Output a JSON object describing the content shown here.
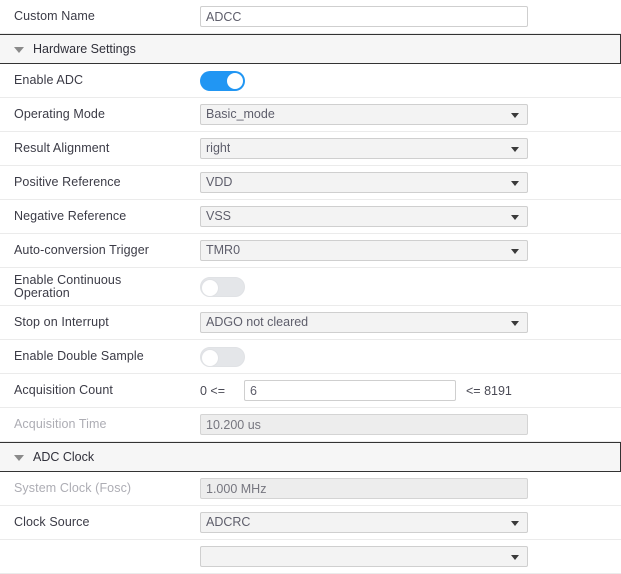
{
  "custom_name_row": {
    "label": "Custom Name",
    "value": "ADCC"
  },
  "sections": {
    "hardware_settings": {
      "title": "Hardware Settings",
      "caret": "caret-down-icon"
    },
    "adc_clock": {
      "title": "ADC Clock",
      "caret": "caret-down-icon"
    }
  },
  "help_glyph": "?",
  "rows": {
    "enable_adc": {
      "label": "Enable ADC",
      "toggle": "on"
    },
    "operating_mode": {
      "label": "Operating Mode",
      "value": "Basic_mode"
    },
    "result_alignment": {
      "label": "Result Alignment",
      "value": "right"
    },
    "positive_reference": {
      "label": "Positive Reference",
      "value": "VDD"
    },
    "negative_reference": {
      "label": "Negative Reference",
      "value": "VSS"
    },
    "auto_conversion_trigger": {
      "label": "Auto-conversion Trigger",
      "value": "TMR0"
    },
    "enable_continuous_operation": {
      "label_line1": "Enable Continuous",
      "label_line2": "Operation",
      "toggle": "off"
    },
    "stop_on_interrupt": {
      "label": "Stop on Interrupt",
      "value": "ADGO not cleared"
    },
    "enable_double_sample": {
      "label": "Enable Double Sample",
      "toggle": "off"
    },
    "acquisition_count": {
      "label": "Acquisition Count",
      "min_text": "0 <=",
      "value": "6",
      "max_text": "<= 8191"
    },
    "acquisition_time": {
      "label": "Acquisition Time",
      "value": "10.200 us"
    },
    "system_clock_fosc": {
      "label": "System Clock (Fosc)",
      "value": "1.000 MHz"
    },
    "clock_source": {
      "label": "Clock Source",
      "value": "ADCRC"
    }
  },
  "colors": {
    "accent_toggle_on": "#2196f3",
    "help_icon": "#9ccdf0",
    "section_bg": "#f6f6f6",
    "dropdown_bg": "#f3f3f3",
    "readonly_bg": "#ededed"
  }
}
